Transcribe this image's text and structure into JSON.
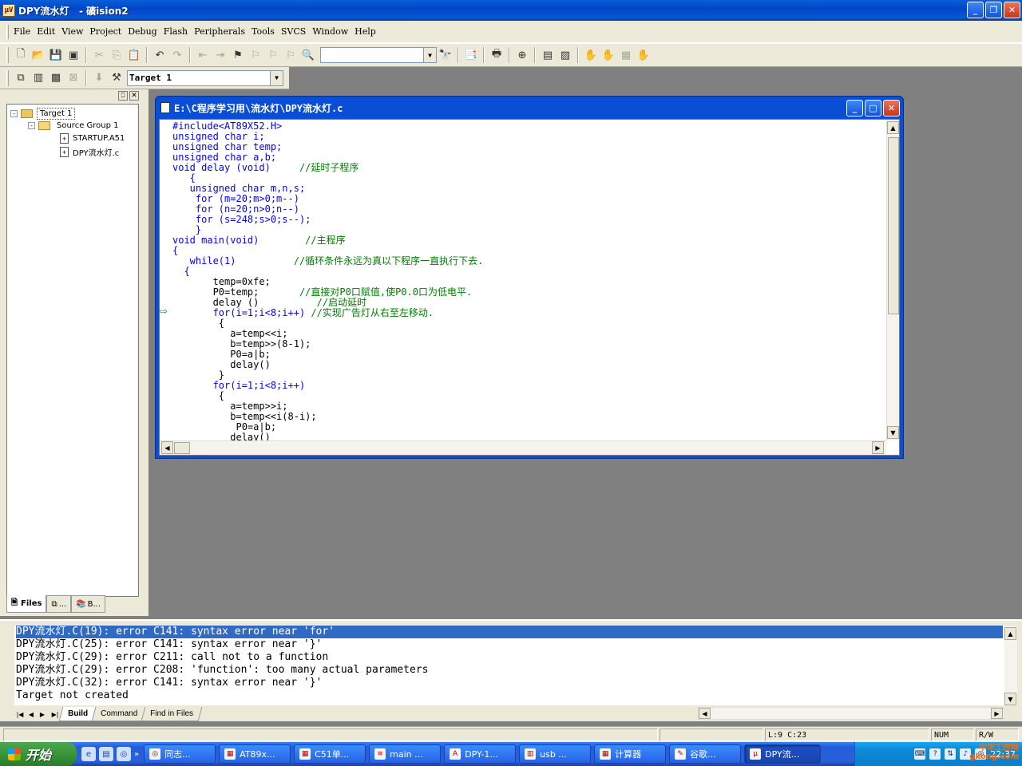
{
  "window": {
    "title": "DPY流水灯   - 礦ision2"
  },
  "menu": [
    "File",
    "Edit",
    "View",
    "Project",
    "Debug",
    "Flash",
    "Peripherals",
    "Tools",
    "SVCS",
    "Window",
    "Help"
  ],
  "toolbar2": {
    "target_value": "Target 1"
  },
  "project": {
    "tree": [
      {
        "label": "Target 1",
        "expander": "-"
      },
      {
        "label": "Source Group 1",
        "expander": "-"
      },
      {
        "label": "STARTUP.A51"
      },
      {
        "label": "DPY流水灯.c"
      }
    ],
    "tabs": [
      "Files",
      "...",
      "B..."
    ]
  },
  "editor": {
    "title": "E:\\C程序学习用\\流水灯\\DPY流水灯.c",
    "lines": [
      [
        [
          "kw",
          "#include<AT89X52.H>"
        ]
      ],
      [
        [
          "kw",
          "unsigned char i;"
        ]
      ],
      [
        [
          "kw",
          "unsigned char temp;"
        ]
      ],
      [
        [
          "kw",
          "unsigned char a,b;"
        ]
      ],
      [
        [
          "kw",
          "void delay (void)"
        ],
        [
          "sp",
          "     "
        ],
        [
          "cm",
          "//延时子程序"
        ]
      ],
      [
        [
          "kw",
          "   {"
        ]
      ],
      [
        [
          "kw",
          "   unsigned char m,n,s;"
        ]
      ],
      [
        [
          "kw",
          "    for (m=20;m>0;m--)"
        ]
      ],
      [
        [
          "kw",
          "    for (n=20;n>0;n--)"
        ]
      ],
      [
        [
          "kw",
          "    for (s=248;s>0;s--);"
        ]
      ],
      [
        [
          "kw",
          "    }"
        ]
      ],
      [
        [
          "kw",
          "void main(void)"
        ],
        [
          "sp",
          "        "
        ],
        [
          "cm",
          "//主程序"
        ]
      ],
      [
        [
          "kw",
          "{"
        ]
      ],
      [
        [
          "kw",
          "   while(1)"
        ],
        [
          "sp",
          "          "
        ],
        [
          "cm",
          "//循环条件永远为真以下程序一直执行下去."
        ]
      ],
      [
        [
          "kw",
          "  {"
        ]
      ],
      [
        [
          "tx",
          "       temp=0xfe;"
        ]
      ],
      [
        [
          "tx",
          "       P0=temp;"
        ],
        [
          "sp",
          "       "
        ],
        [
          "cm",
          "//直接对P0口赋值,使P0.0口为低电平."
        ]
      ],
      [
        [
          "tx",
          "       delay ()"
        ],
        [
          "sp",
          "          "
        ],
        [
          "cm",
          "//启动延时"
        ]
      ],
      [
        [
          "kw",
          "       for(i=1;i<8;i++)"
        ],
        [
          "sp",
          " "
        ],
        [
          "cm",
          "//实现广告灯从右至左移动."
        ]
      ],
      [
        [
          "tx",
          "        {"
        ]
      ],
      [
        [
          "tx",
          "          a=temp<<i;"
        ]
      ],
      [
        [
          "tx",
          "          b=temp>>(8-1);"
        ]
      ],
      [
        [
          "tx",
          "          P0=a|b;"
        ]
      ],
      [
        [
          "tx",
          "          delay()"
        ]
      ],
      [
        [
          "tx",
          "        }"
        ]
      ],
      [
        [
          "kw",
          "       for(i=1;i<8;i++)"
        ]
      ],
      [
        [
          "tx",
          "        {"
        ]
      ],
      [
        [
          "tx",
          "          a=temp>>i;"
        ]
      ],
      [
        [
          "tx",
          "          b=temp<<i(8-i);"
        ]
      ],
      [
        [
          "tx",
          "           P0=a|b;"
        ]
      ],
      [
        [
          "tx",
          "          delay()"
        ]
      ]
    ],
    "current_line_marker": "⇨"
  },
  "output": {
    "lines": [
      "DPY流水灯.C(19): error C141: syntax error near 'for'",
      "DPY流水灯.C(25): error C141: syntax error near '}'",
      "DPY流水灯.C(29): error C211: call not to a function",
      "DPY流水灯.C(29): error C208: 'function': too many actual parameters",
      "DPY流水灯.C(32): error C141: syntax error near '}'",
      "Target not created"
    ],
    "tabs": [
      "Build",
      "Command",
      "Find in Files"
    ]
  },
  "status": {
    "position": "L:9 C:23",
    "num": "NUM",
    "rw": "R/W"
  },
  "taskbar": {
    "start": "开始",
    "tasks": [
      "同志...",
      "AT89x...",
      "C51单...",
      "main ...",
      "DPY-1...",
      "usb ...",
      "计算器",
      "谷歌...",
      "DPY流..."
    ],
    "clock": "22:37",
    "watermark": "中华工控网",
    "watermark_url": "gkong.com"
  },
  "colors": {
    "titlebar": "#0046c8",
    "editor_keyword": "#0000ff",
    "editor_comment": "#008000",
    "selection": "#316ac5"
  }
}
